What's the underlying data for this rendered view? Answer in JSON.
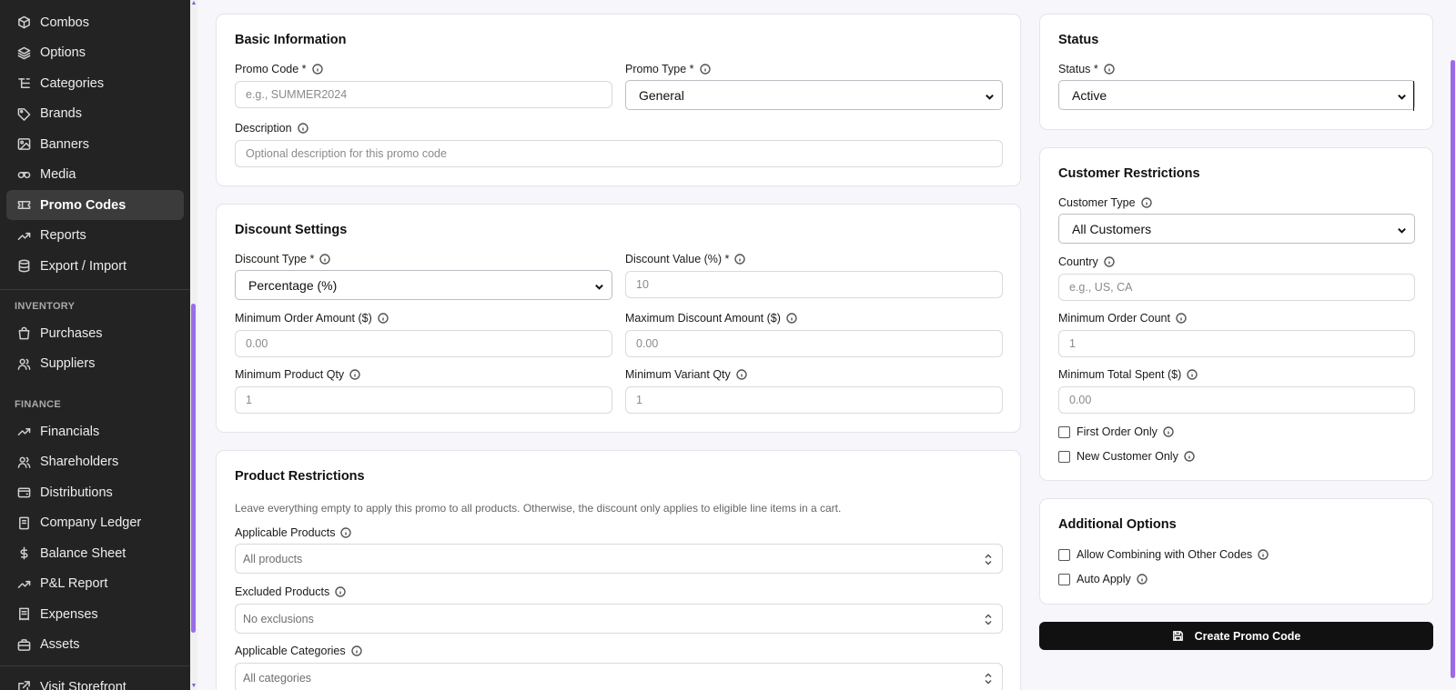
{
  "sidebar": {
    "items_top": [
      {
        "label": "Combos",
        "icon": "cube-icon"
      },
      {
        "label": "Options",
        "icon": "layers-icon"
      },
      {
        "label": "Categories",
        "icon": "list-tree-icon"
      },
      {
        "label": "Brands",
        "icon": "tag-icon"
      },
      {
        "label": "Banners",
        "icon": "image-icon"
      },
      {
        "label": "Media",
        "icon": "film-icon"
      },
      {
        "label": "Promo Codes",
        "icon": "ticket-icon",
        "active": true
      },
      {
        "label": "Reports",
        "icon": "trending-up-icon"
      },
      {
        "label": "Export / Import",
        "icon": "database-icon"
      }
    ],
    "inventory_heading": "INVENTORY",
    "items_inventory": [
      {
        "label": "Purchases",
        "icon": "shopping-bag-icon"
      },
      {
        "label": "Suppliers",
        "icon": "users-icon"
      }
    ],
    "finance_heading": "FINANCE",
    "items_finance": [
      {
        "label": "Financials",
        "icon": "trending-up-icon"
      },
      {
        "label": "Shareholders",
        "icon": "users-icon"
      },
      {
        "label": "Distributions",
        "icon": "wallet-icon"
      },
      {
        "label": "Company Ledger",
        "icon": "book-icon"
      },
      {
        "label": "Balance Sheet",
        "icon": "dollar-icon"
      },
      {
        "label": "P&L Report",
        "icon": "trending-up-icon"
      },
      {
        "label": "Expenses",
        "icon": "receipt-icon"
      },
      {
        "label": "Assets",
        "icon": "briefcase-icon"
      }
    ],
    "visit_storefront": "Visit Storefront"
  },
  "basic": {
    "title": "Basic Information",
    "promo_code_label": "Promo Code *",
    "promo_code_placeholder": "e.g., SUMMER2024",
    "promo_type_label": "Promo Type *",
    "promo_type_value": "General",
    "description_label": "Description",
    "description_placeholder": "Optional description for this promo code"
  },
  "discount": {
    "title": "Discount Settings",
    "type_label": "Discount Type *",
    "type_value": "Percentage (%)",
    "value_label": "Discount Value (%) *",
    "value_placeholder": "10",
    "min_order_label": "Minimum Order Amount ($)",
    "min_order_placeholder": "0.00",
    "max_discount_label": "Maximum Discount Amount ($)",
    "max_discount_placeholder": "0.00",
    "min_product_label": "Minimum Product Qty",
    "min_product_placeholder": "1",
    "min_variant_label": "Minimum Variant Qty",
    "min_variant_placeholder": "1"
  },
  "product": {
    "title": "Product Restrictions",
    "helper": "Leave everything empty to apply this promo to all products. Otherwise, the discount only applies to eligible line items in a cart.",
    "applicable_label": "Applicable Products",
    "applicable_value": "All products",
    "excluded_label": "Excluded Products",
    "excluded_value": "No exclusions",
    "categories_label": "Applicable Categories",
    "categories_value": "All categories"
  },
  "status": {
    "title": "Status",
    "label": "Status *",
    "value": "Active"
  },
  "customer": {
    "title": "Customer Restrictions",
    "type_label": "Customer Type",
    "type_value": "All Customers",
    "country_label": "Country",
    "country_placeholder": "e.g., US, CA",
    "min_count_label": "Minimum Order Count",
    "min_count_placeholder": "1",
    "min_spent_label": "Minimum Total Spent ($)",
    "min_spent_placeholder": "0.00",
    "first_order_label": "First Order Only",
    "new_customer_label": "New Customer Only"
  },
  "additional": {
    "title": "Additional Options",
    "combine_label": "Allow Combining with Other Codes",
    "auto_apply_label": "Auto Apply"
  },
  "create_button": "Create Promo Code"
}
